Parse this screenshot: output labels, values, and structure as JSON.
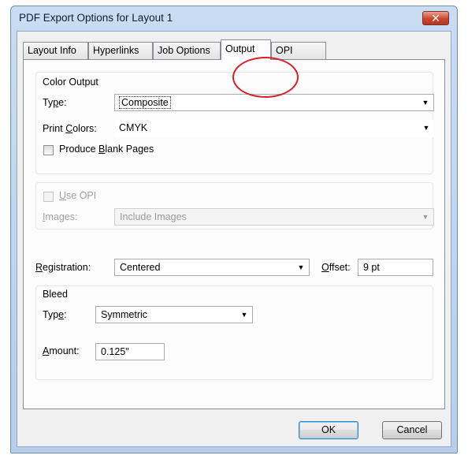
{
  "window": {
    "title": "PDF Export Options for Layout 1",
    "close_glyph": "✕"
  },
  "tabs": [
    {
      "label": "Layout Info"
    },
    {
      "label": "Hyperlinks"
    },
    {
      "label": "Job Options"
    },
    {
      "label": "Output",
      "active": true
    },
    {
      "label": "OPI"
    }
  ],
  "color_output": {
    "heading": "Color Output",
    "type_label_pre": "Ty",
    "type_label_u": "p",
    "type_label_post": "e:",
    "type_value": "Composite",
    "print_colors_label_pre": "Print ",
    "print_colors_label_u": "C",
    "print_colors_label_post": "olors:",
    "print_colors_value": "CMYK",
    "blank_pages_pre": "Produce ",
    "blank_pages_u": "B",
    "blank_pages_post": "lank Pages",
    "blank_pages_checked": false
  },
  "opi": {
    "use_opi_u": "U",
    "use_opi_post": "se OPI",
    "use_opi_checked": false,
    "images_label_u": "I",
    "images_label_post": "mages:",
    "images_value": "Include Images"
  },
  "registration": {
    "label_u": "R",
    "label_post": "egistration:",
    "value": "Centered",
    "offset_label_u": "O",
    "offset_label_post": "ffset:",
    "offset_value": "9 pt"
  },
  "bleed": {
    "heading": "Bleed",
    "type_label_pre": "Typ",
    "type_label_u": "e",
    "type_label_post": ":",
    "type_value": "Symmetric",
    "amount_label_u": "A",
    "amount_label_post": "mount:",
    "amount_value": "0.125\""
  },
  "buttons": {
    "ok": "OK",
    "cancel": "Cancel"
  },
  "icons": {
    "dropdown": "chevron-down-icon",
    "close": "close-icon"
  },
  "colors": {
    "annotation_circle": "#d2232a",
    "close_button": "#c9462c"
  }
}
